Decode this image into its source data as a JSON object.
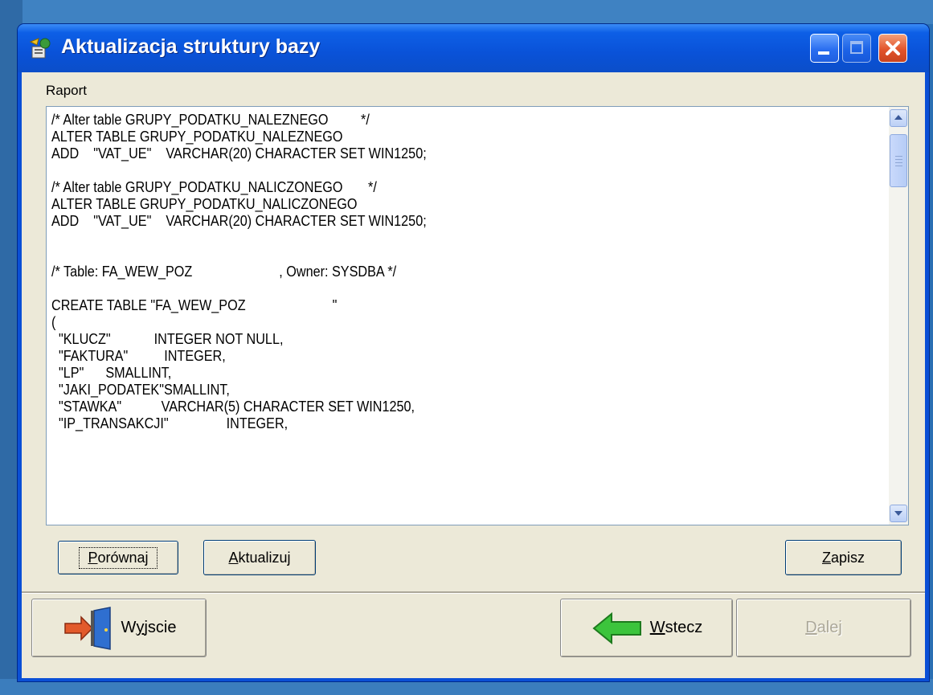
{
  "window": {
    "title": "Aktualizacja struktury bazy"
  },
  "report": {
    "label": "Raport",
    "lines": [
      "/* Alter table GRUPY_PODATKU_NALEZNEGO         */",
      "ALTER TABLE GRUPY_PODATKU_NALEZNEGO",
      "ADD    \"VAT_UE\"    VARCHAR(20) CHARACTER SET WIN1250;",
      "",
      "/* Alter table GRUPY_PODATKU_NALICZONEGO       */",
      "ALTER TABLE GRUPY_PODATKU_NALICZONEGO",
      "ADD    \"VAT_UE\"    VARCHAR(20) CHARACTER SET WIN1250;",
      "",
      "",
      "/* Table: FA_WEW_POZ                        , Owner: SYSDBA */",
      "",
      "CREATE TABLE \"FA_WEW_POZ                        \"",
      "(",
      "  \"KLUCZ\"            INTEGER NOT NULL,",
      "  \"FAKTURA\"          INTEGER,",
      "  \"LP\"      SMALLINT,",
      "  \"JAKI_PODATEK\"SMALLINT,",
      "  \"STAWKA\"           VARCHAR(5) CHARACTER SET WIN1250,",
      "  \"IP_TRANSAKCJI\"                INTEGER,"
    ]
  },
  "buttons": {
    "porownaj": {
      "label": "Porównaj",
      "mnemonic": "P",
      "rest": "orównaj"
    },
    "aktualizuj": {
      "label": "Aktualizuj",
      "mnemonic": "A",
      "rest": "ktualizuj"
    },
    "zapisz": {
      "label": "Zapisz",
      "mnemonic": "Z",
      "rest": "apisz"
    },
    "wyjscie": {
      "label": "Wyjscie",
      "pre": "W",
      "mnemonic": "y",
      "rest": "jscie"
    },
    "wstecz": {
      "label": "Wstecz",
      "mnemonic": "W",
      "rest": "stecz"
    },
    "dalej": {
      "label": "Dalej",
      "mnemonic": "D",
      "rest": "alej"
    }
  },
  "icons": {
    "app": "database-update-icon",
    "wyjscie": "exit-door-icon",
    "wstecz": "green-left-arrow-icon"
  },
  "colors": {
    "titlebar": "#0a52d8",
    "client_bg": "#ece9d8",
    "close_button": "#e2542b",
    "disabled_text": "#aca899"
  }
}
